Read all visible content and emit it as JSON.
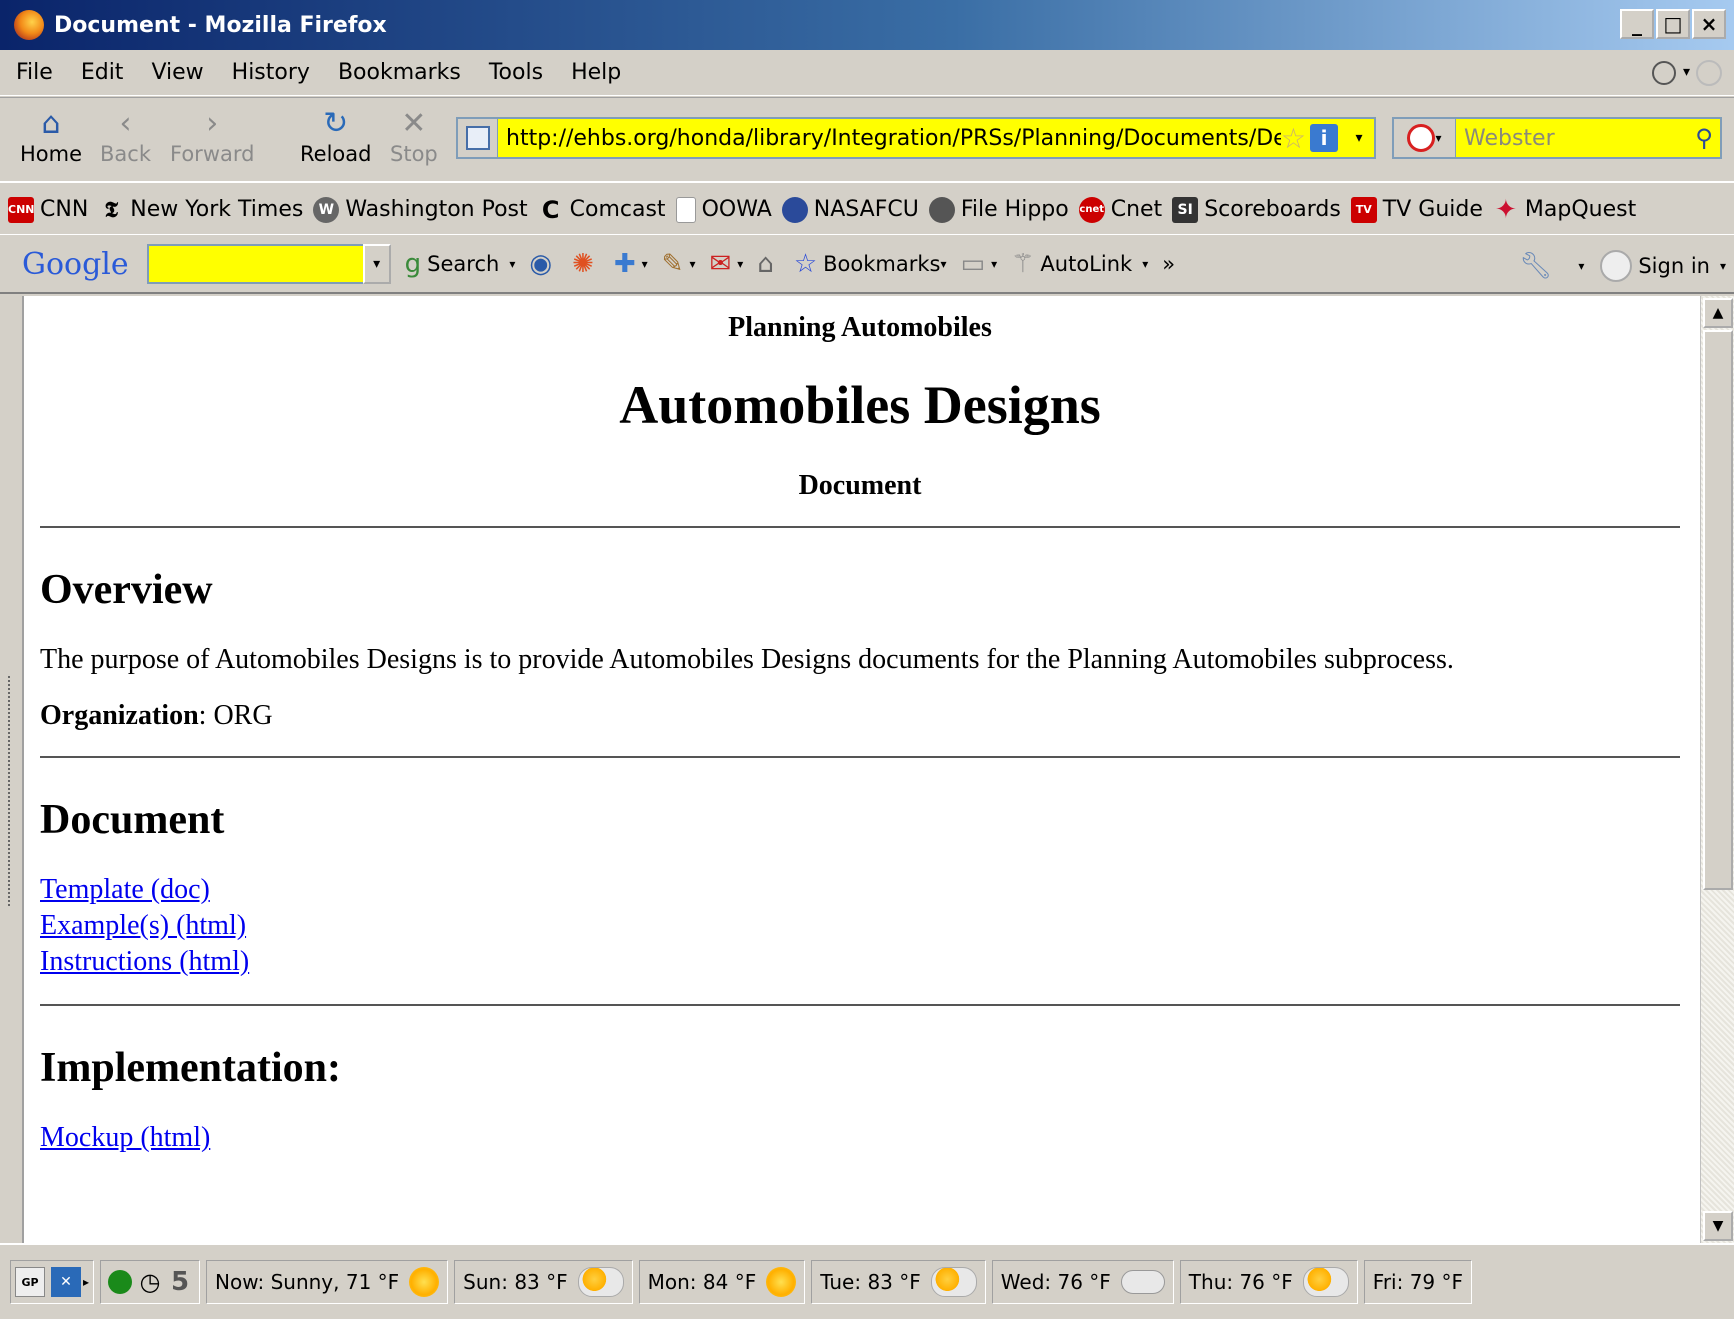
{
  "window": {
    "title": "Document - Mozilla Firefox",
    "controls": [
      "_",
      "□",
      "×"
    ]
  },
  "menu": [
    "File",
    "Edit",
    "View",
    "History",
    "Bookmarks",
    "Tools",
    "Help"
  ],
  "nav": {
    "home": "Home",
    "back": "Back",
    "forward": "Forward",
    "reload": "Reload",
    "stop": "Stop",
    "url": "http://ehbs.org/honda/library/Integration/PRSs/Planning/Documents/Designs",
    "search_placeholder": "Webster"
  },
  "bookmarks": [
    {
      "label": "CNN",
      "icon": "cnn-icon"
    },
    {
      "label": "New York Times",
      "icon": "nyt-icon"
    },
    {
      "label": "Washington Post",
      "icon": "wapo-icon"
    },
    {
      "label": "Comcast",
      "icon": "comcast-icon"
    },
    {
      "label": "OOWA",
      "icon": "page-icon"
    },
    {
      "label": "NASAFCU",
      "icon": "nasafcu-icon"
    },
    {
      "label": "File Hippo",
      "icon": "filehippo-icon"
    },
    {
      "label": "Cnet",
      "icon": "cnet-icon"
    },
    {
      "label": "Scoreboards",
      "icon": "si-icon"
    },
    {
      "label": "TV Guide",
      "icon": "tvguide-icon"
    },
    {
      "label": "MapQuest",
      "icon": "mapquest-icon"
    }
  ],
  "google_toolbar": {
    "logo": "Google",
    "search": "Search",
    "bookmarks": "Bookmarks",
    "autolink": "AutoLink",
    "more": "»",
    "signin": "Sign in"
  },
  "page": {
    "project": "Planning Automobiles",
    "title": "Automobiles Designs",
    "subtitle": "Document",
    "overview_heading": "Overview",
    "overview_text": "The purpose of Automobiles Designs is to provide Automobiles Designs documents for the Planning Automobiles subprocess.",
    "org_label": "Organization",
    "org_value": ": ORG",
    "document_heading": "Document",
    "doc_links": [
      "Template (doc)",
      "Example(s) (html)",
      "Instructions (html)"
    ],
    "implementation_heading": "Implementation:",
    "impl_links": [
      "Mockup (html)"
    ]
  },
  "status": {
    "gp": "GP",
    "count": "5",
    "weather": [
      {
        "label": "Now: Sunny, 71 °F",
        "icon": "sun"
      },
      {
        "label": "Sun: 83 °F",
        "icon": "suncloud"
      },
      {
        "label": "Mon: 84 °F",
        "icon": "sun"
      },
      {
        "label": "Tue: 83 °F",
        "icon": "suncloud"
      },
      {
        "label": "Wed: 76 °F",
        "icon": "cloud"
      },
      {
        "label": "Thu: 76 °F",
        "icon": "suncloud"
      },
      {
        "label": "Fri: 79 °F",
        "icon": "suncloud"
      }
    ]
  }
}
